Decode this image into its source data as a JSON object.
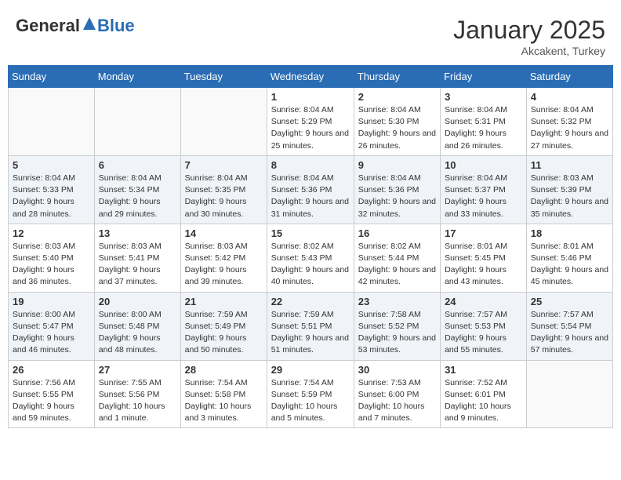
{
  "header": {
    "logo_general": "General",
    "logo_blue": "Blue",
    "month_year": "January 2025",
    "location": "Akcakent, Turkey"
  },
  "days_of_week": [
    "Sunday",
    "Monday",
    "Tuesday",
    "Wednesday",
    "Thursday",
    "Friday",
    "Saturday"
  ],
  "weeks": [
    [
      {
        "day": "",
        "sunrise": "",
        "sunset": "",
        "daylight": "",
        "empty": true
      },
      {
        "day": "",
        "sunrise": "",
        "sunset": "",
        "daylight": "",
        "empty": true
      },
      {
        "day": "",
        "sunrise": "",
        "sunset": "",
        "daylight": "",
        "empty": true
      },
      {
        "day": "1",
        "sunrise": "Sunrise: 8:04 AM",
        "sunset": "Sunset: 5:29 PM",
        "daylight": "Daylight: 9 hours and 25 minutes."
      },
      {
        "day": "2",
        "sunrise": "Sunrise: 8:04 AM",
        "sunset": "Sunset: 5:30 PM",
        "daylight": "Daylight: 9 hours and 26 minutes."
      },
      {
        "day": "3",
        "sunrise": "Sunrise: 8:04 AM",
        "sunset": "Sunset: 5:31 PM",
        "daylight": "Daylight: 9 hours and 26 minutes."
      },
      {
        "day": "4",
        "sunrise": "Sunrise: 8:04 AM",
        "sunset": "Sunset: 5:32 PM",
        "daylight": "Daylight: 9 hours and 27 minutes."
      }
    ],
    [
      {
        "day": "5",
        "sunrise": "Sunrise: 8:04 AM",
        "sunset": "Sunset: 5:33 PM",
        "daylight": "Daylight: 9 hours and 28 minutes."
      },
      {
        "day": "6",
        "sunrise": "Sunrise: 8:04 AM",
        "sunset": "Sunset: 5:34 PM",
        "daylight": "Daylight: 9 hours and 29 minutes."
      },
      {
        "day": "7",
        "sunrise": "Sunrise: 8:04 AM",
        "sunset": "Sunset: 5:35 PM",
        "daylight": "Daylight: 9 hours and 30 minutes."
      },
      {
        "day": "8",
        "sunrise": "Sunrise: 8:04 AM",
        "sunset": "Sunset: 5:36 PM",
        "daylight": "Daylight: 9 hours and 31 minutes."
      },
      {
        "day": "9",
        "sunrise": "Sunrise: 8:04 AM",
        "sunset": "Sunset: 5:36 PM",
        "daylight": "Daylight: 9 hours and 32 minutes."
      },
      {
        "day": "10",
        "sunrise": "Sunrise: 8:04 AM",
        "sunset": "Sunset: 5:37 PM",
        "daylight": "Daylight: 9 hours and 33 minutes."
      },
      {
        "day": "11",
        "sunrise": "Sunrise: 8:03 AM",
        "sunset": "Sunset: 5:39 PM",
        "daylight": "Daylight: 9 hours and 35 minutes."
      }
    ],
    [
      {
        "day": "12",
        "sunrise": "Sunrise: 8:03 AM",
        "sunset": "Sunset: 5:40 PM",
        "daylight": "Daylight: 9 hours and 36 minutes."
      },
      {
        "day": "13",
        "sunrise": "Sunrise: 8:03 AM",
        "sunset": "Sunset: 5:41 PM",
        "daylight": "Daylight: 9 hours and 37 minutes."
      },
      {
        "day": "14",
        "sunrise": "Sunrise: 8:03 AM",
        "sunset": "Sunset: 5:42 PM",
        "daylight": "Daylight: 9 hours and 39 minutes."
      },
      {
        "day": "15",
        "sunrise": "Sunrise: 8:02 AM",
        "sunset": "Sunset: 5:43 PM",
        "daylight": "Daylight: 9 hours and 40 minutes."
      },
      {
        "day": "16",
        "sunrise": "Sunrise: 8:02 AM",
        "sunset": "Sunset: 5:44 PM",
        "daylight": "Daylight: 9 hours and 42 minutes."
      },
      {
        "day": "17",
        "sunrise": "Sunrise: 8:01 AM",
        "sunset": "Sunset: 5:45 PM",
        "daylight": "Daylight: 9 hours and 43 minutes."
      },
      {
        "day": "18",
        "sunrise": "Sunrise: 8:01 AM",
        "sunset": "Sunset: 5:46 PM",
        "daylight": "Daylight: 9 hours and 45 minutes."
      }
    ],
    [
      {
        "day": "19",
        "sunrise": "Sunrise: 8:00 AM",
        "sunset": "Sunset: 5:47 PM",
        "daylight": "Daylight: 9 hours and 46 minutes."
      },
      {
        "day": "20",
        "sunrise": "Sunrise: 8:00 AM",
        "sunset": "Sunset: 5:48 PM",
        "daylight": "Daylight: 9 hours and 48 minutes."
      },
      {
        "day": "21",
        "sunrise": "Sunrise: 7:59 AM",
        "sunset": "Sunset: 5:49 PM",
        "daylight": "Daylight: 9 hours and 50 minutes."
      },
      {
        "day": "22",
        "sunrise": "Sunrise: 7:59 AM",
        "sunset": "Sunset: 5:51 PM",
        "daylight": "Daylight: 9 hours and 51 minutes."
      },
      {
        "day": "23",
        "sunrise": "Sunrise: 7:58 AM",
        "sunset": "Sunset: 5:52 PM",
        "daylight": "Daylight: 9 hours and 53 minutes."
      },
      {
        "day": "24",
        "sunrise": "Sunrise: 7:57 AM",
        "sunset": "Sunset: 5:53 PM",
        "daylight": "Daylight: 9 hours and 55 minutes."
      },
      {
        "day": "25",
        "sunrise": "Sunrise: 7:57 AM",
        "sunset": "Sunset: 5:54 PM",
        "daylight": "Daylight: 9 hours and 57 minutes."
      }
    ],
    [
      {
        "day": "26",
        "sunrise": "Sunrise: 7:56 AM",
        "sunset": "Sunset: 5:55 PM",
        "daylight": "Daylight: 9 hours and 59 minutes."
      },
      {
        "day": "27",
        "sunrise": "Sunrise: 7:55 AM",
        "sunset": "Sunset: 5:56 PM",
        "daylight": "Daylight: 10 hours and 1 minute."
      },
      {
        "day": "28",
        "sunrise": "Sunrise: 7:54 AM",
        "sunset": "Sunset: 5:58 PM",
        "daylight": "Daylight: 10 hours and 3 minutes."
      },
      {
        "day": "29",
        "sunrise": "Sunrise: 7:54 AM",
        "sunset": "Sunset: 5:59 PM",
        "daylight": "Daylight: 10 hours and 5 minutes."
      },
      {
        "day": "30",
        "sunrise": "Sunrise: 7:53 AM",
        "sunset": "Sunset: 6:00 PM",
        "daylight": "Daylight: 10 hours and 7 minutes."
      },
      {
        "day": "31",
        "sunrise": "Sunrise: 7:52 AM",
        "sunset": "Sunset: 6:01 PM",
        "daylight": "Daylight: 10 hours and 9 minutes."
      },
      {
        "day": "",
        "sunrise": "",
        "sunset": "",
        "daylight": "",
        "empty": true
      }
    ]
  ]
}
